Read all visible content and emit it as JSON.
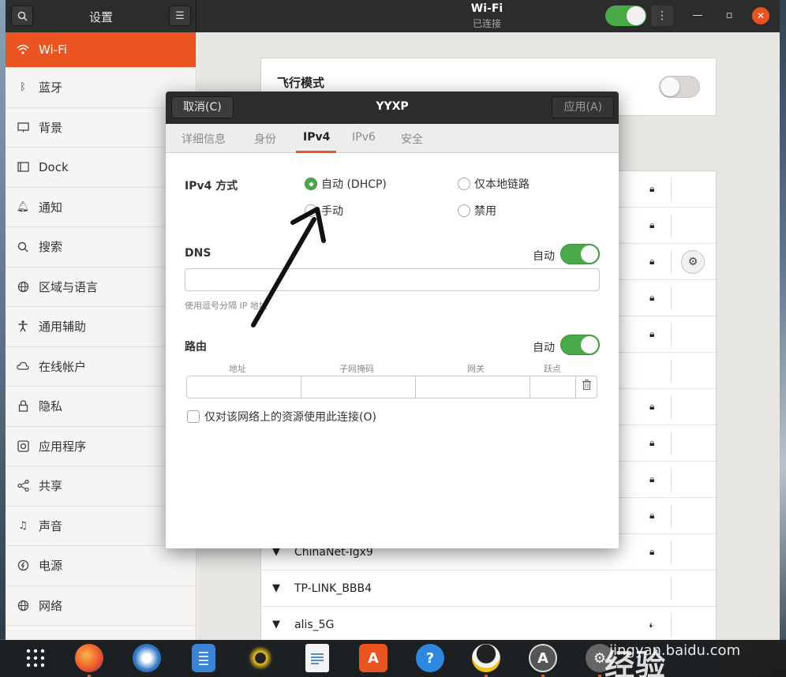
{
  "window": {
    "sidebar_title": "设置",
    "title": "Wi-Fi",
    "subtitle": "已连接"
  },
  "sidebar": {
    "items": [
      {
        "label": "Wi-Fi",
        "icon": "wifi-icon"
      },
      {
        "label": "蓝牙",
        "icon": "bluetooth-icon"
      },
      {
        "label": "背景",
        "icon": "background-icon"
      },
      {
        "label": "Dock",
        "icon": "dock-icon"
      },
      {
        "label": "通知",
        "icon": "bell-icon"
      },
      {
        "label": "搜索",
        "icon": "search-icon"
      },
      {
        "label": "区域与语言",
        "icon": "globe-icon"
      },
      {
        "label": "通用辅助",
        "icon": "accessibility-icon"
      },
      {
        "label": "在线帐户",
        "icon": "cloud-icon"
      },
      {
        "label": "隐私",
        "icon": "lock-icon"
      },
      {
        "label": "应用程序",
        "icon": "apps-icon"
      },
      {
        "label": "共享",
        "icon": "share-icon"
      },
      {
        "label": "声音",
        "icon": "music-icon"
      },
      {
        "label": "电源",
        "icon": "power-icon"
      },
      {
        "label": "网络",
        "icon": "network-icon"
      }
    ]
  },
  "main": {
    "airplane_label": "飞行模式",
    "networks": [
      {
        "name": "ChinaNet-Igx9"
      },
      {
        "name": "TP-LINK_BBB4"
      },
      {
        "name": "alis_5G"
      }
    ]
  },
  "dialog": {
    "cancel_label": "取消(C)",
    "title": "YYXP",
    "apply_label": "应用(A)",
    "tabs": [
      "详细信息",
      "身份",
      "IPv4",
      "IPv6",
      "安全"
    ],
    "active_tab": "IPv4",
    "ipv4_method_label": "IPv4 方式",
    "methods": {
      "auto": "自动 (DHCP)",
      "link_local": "仅本地链路",
      "manual": "手动",
      "disable": "禁用"
    },
    "selected_method": "自动 (DHCP)",
    "dns_label": "DNS",
    "dns_auto_label": "自动",
    "dns_value": "",
    "dns_hint": "使用逗号分隔 IP 地址",
    "routes_label": "路由",
    "routes_auto_label": "自动",
    "route_columns": [
      "地址",
      "子网掩码",
      "网关",
      "跃点"
    ],
    "only_resources_label": "仅对该网络上的资源使用此连接(O)"
  },
  "watermark": {
    "logo": "Bai du 经验",
    "url": "jingyan.baidu.com"
  },
  "colors": {
    "accent": "#e95420",
    "switch_on": "#4aaa4a",
    "titlebar": "#2c2c2c"
  }
}
